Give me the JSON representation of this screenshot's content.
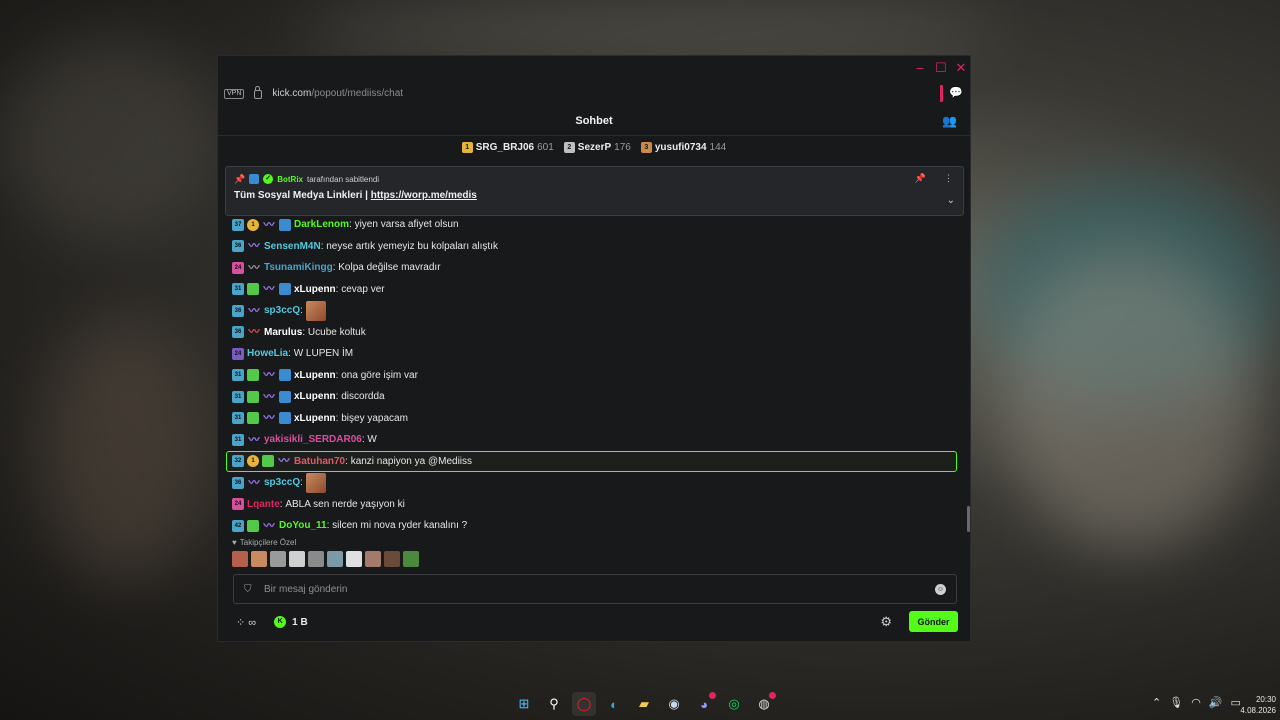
{
  "browser": {
    "vpn_label": "VPN",
    "url_host": "kick.com",
    "url_path": "/popout/mediiss/chat"
  },
  "chat": {
    "title": "Sohbet",
    "leaderboard": [
      {
        "rank": "1",
        "name": "SRG_BRJ06",
        "score": "601",
        "color": "#e7b43a"
      },
      {
        "rank": "2",
        "name": "SezerP",
        "score": "176",
        "color": "#bfbfbf"
      },
      {
        "rank": "3",
        "name": "yusufi0734",
        "score": "144",
        "color": "#c98a4a"
      }
    ],
    "pinned": {
      "bot_name": "BotRix",
      "pinned_by_suffix": "tarafından sabitlendi",
      "text_prefix": "Tüm Sosyal Medya Linkleri |",
      "link": "https://worp.me/medis"
    },
    "messages": [
      {
        "user": "DarkLenom",
        "text": "yiyen varsa afiyet olsun",
        "color": "#53fc18"
      },
      {
        "user": "SensenM4N",
        "text": "neyse artık yemeyiz bu kolpaları alıştık",
        "color": "#53c9e0"
      },
      {
        "user": "TsunamiKingg",
        "text": "Kolpa değilse mavradır",
        "color": "#4aa3c8"
      },
      {
        "user": "xLupenn",
        "text": "cevap ver",
        "color": "#ffffff"
      },
      {
        "user": "sp3ccQ",
        "text": "",
        "color": "#53c9e0"
      },
      {
        "user": "Marulus",
        "text": "Ucube koltuk",
        "color": "#ffffff"
      },
      {
        "user": "HoweLia",
        "text": "W LUPEN İM",
        "color": "#53c9e0"
      },
      {
        "user": "xLupenn",
        "text": "ona göre işim var",
        "color": "#ffffff"
      },
      {
        "user": "xLupenn",
        "text": "discordda",
        "color": "#ffffff"
      },
      {
        "user": "xLupenn",
        "text": "bişey yapacam",
        "color": "#ffffff"
      },
      {
        "user": "yakisikli_SERDAR06",
        "text": "W",
        "color": "#d94fa0"
      },
      {
        "user": "Batuhan70",
        "text": "kanzi napiyon ya @Mediiss",
        "color": "#e05a6a"
      },
      {
        "user": "sp3ccQ",
        "text": "",
        "color": "#53c9e0"
      },
      {
        "user": "Lqante",
        "text": "ABLA sen nerde yaşıyon ki",
        "color": "#e0245e"
      },
      {
        "user": "DoYou_11",
        "text": "silcen mi nova ryder kanalını ?",
        "color": "#53fc18"
      }
    ],
    "followers_only_label": "Takipçilere Özel",
    "input_placeholder": "Bir mesaj gönderin",
    "kick_points": "1 B",
    "send_label": "Gönder"
  },
  "taskbar": {
    "time": "20:30",
    "date": "4.08.2026"
  }
}
